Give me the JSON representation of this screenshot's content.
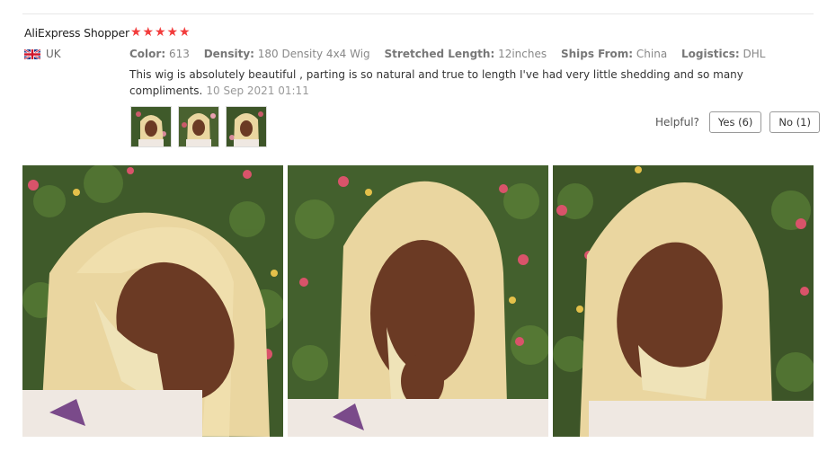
{
  "review": {
    "author": "AliExpress Shopper",
    "country": "UK",
    "rating": 5,
    "attributes": [
      {
        "key": "Color:",
        "value": "613"
      },
      {
        "key": "Density:",
        "value": "180 Density 4x4 Wig"
      },
      {
        "key": "Stretched Length:",
        "value": "12inches"
      },
      {
        "key": "Ships From:",
        "value": "China"
      },
      {
        "key": "Logistics:",
        "value": "DHL"
      }
    ],
    "text": "This wig is absolutely beautiful , parting is so natural and true to length I've had very little shedding and so many compliments.",
    "date": "10 Sep 2021 01:11"
  },
  "helpful": {
    "label": "Helpful?",
    "yes": "Yes (6)",
    "no": "No (1)"
  },
  "colors": {
    "star": "#f23c3c",
    "hair": "#ead6a0",
    "skin": "#6b3a24",
    "foliage": "#3f5a2a",
    "shirt": "#efe8e2"
  }
}
